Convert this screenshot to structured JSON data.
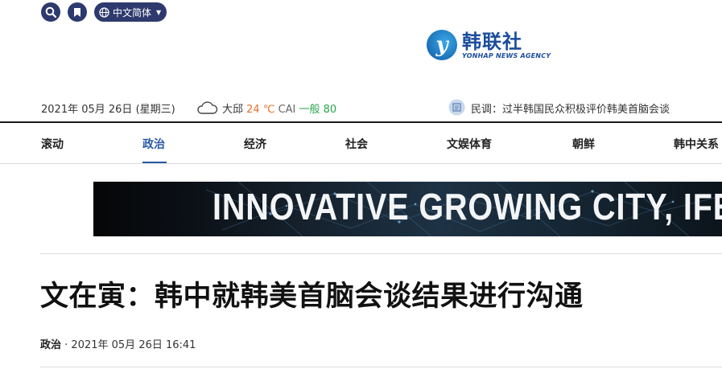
{
  "top": {
    "search_icon": "search-icon",
    "bookmark_icon": "bookmark-icon",
    "language": "中文简体"
  },
  "logo": {
    "mark": "y",
    "name_cn": "韩联社",
    "name_en": "YONHAP NEWS AGENCY"
  },
  "info": {
    "date": "2021年 05月 26日 (星期三)",
    "city": "大邱",
    "temp": "24 ℃",
    "cai_label": "CAI",
    "cai_value": "一般 80",
    "poll": "民调：过半韩国民众积极评价韩美首脑会谈"
  },
  "nav": {
    "items": [
      "滚动",
      "政治",
      "经济",
      "社会",
      "文娱体育",
      "朝鲜",
      "韩中关系"
    ],
    "active": "政治"
  },
  "banner": {
    "text": "INNOVATIVE GROWING CITY, IFE"
  },
  "article": {
    "title": "文在寅：韩中就韩美首脑会谈结果进行沟通",
    "category": "政治",
    "separator": " · ",
    "datetime": "2021年 05月 26日 16:41"
  },
  "colors": {
    "accent": "#2a5aa8",
    "button_bg": "#2e3a6e",
    "temp": "#e8702a",
    "air_good": "#2aa64a"
  }
}
